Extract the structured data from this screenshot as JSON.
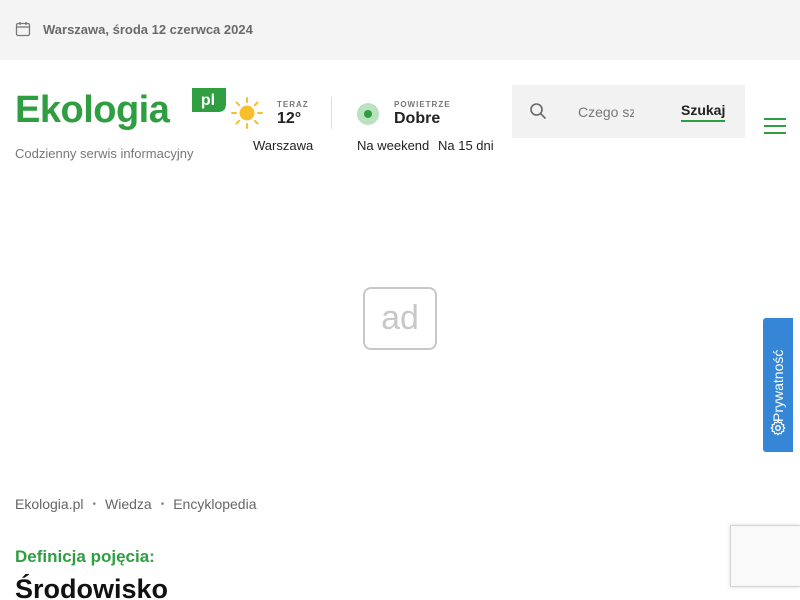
{
  "topbar": {
    "date": "Warszawa, środa 12 czerwca 2024"
  },
  "header": {
    "logo_text": "Ekologia",
    "logo_suffix": "pl",
    "tagline": "Codzienny serwis informacyjny"
  },
  "weather": {
    "now_label": "TERAZ",
    "temperature": "12°",
    "city": "Warszawa",
    "icon": "sun-icon"
  },
  "air": {
    "label": "POWIETRZE",
    "quality": "Dobre",
    "weekend_link": "Na weekend",
    "days15_link": "Na 15 dni"
  },
  "search": {
    "placeholder": "Czego szukasz?",
    "button_label": "Szukaj"
  },
  "ad": {
    "label": "ad"
  },
  "privacy": {
    "label": "Prywatność"
  },
  "breadcrumb": [
    "Ekologia.pl",
    "Wiedza",
    "Encyklopedia"
  ],
  "definition": {
    "label": "Definicja pojęcia:",
    "title": "Środowisko"
  },
  "colors": {
    "brand_green": "#2f9e41",
    "privacy_blue": "#3586d6"
  }
}
